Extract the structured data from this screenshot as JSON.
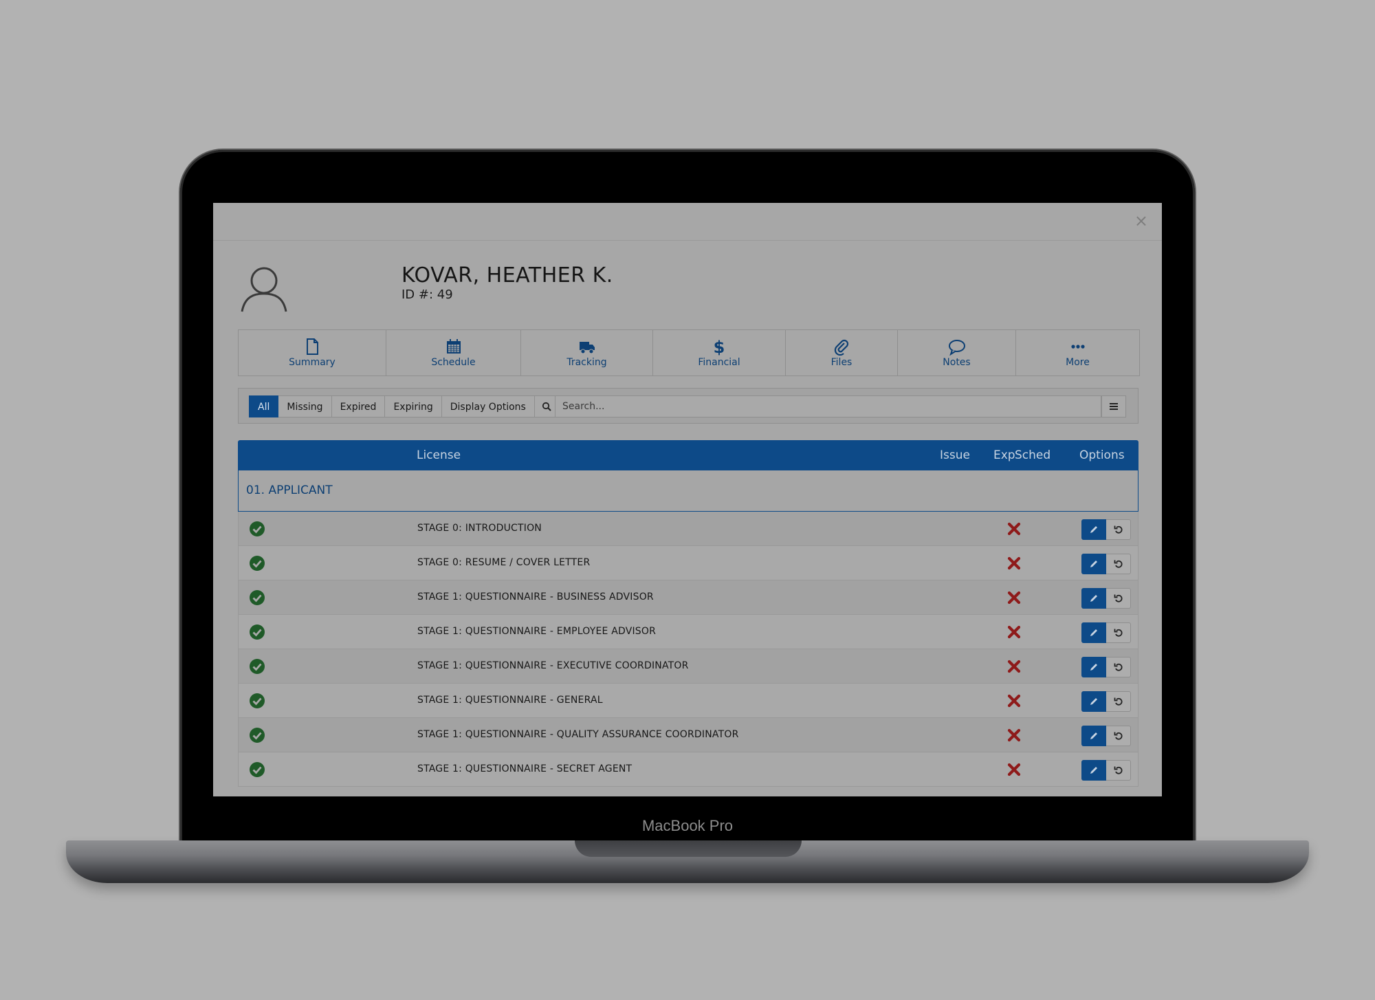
{
  "device": {
    "brand_label": "MacBook Pro"
  },
  "patient": {
    "name": "KOVAR, HEATHER K.",
    "id_line": "ID #: 49"
  },
  "nav_tabs": [
    {
      "label": "Summary",
      "icon": "document-icon"
    },
    {
      "label": "Schedule",
      "icon": "calendar-icon"
    },
    {
      "label": "Tracking",
      "icon": "truck-icon"
    },
    {
      "label": "Financial",
      "icon": "dollar-icon"
    },
    {
      "label": "Files",
      "icon": "paperclip-icon"
    },
    {
      "label": "Notes",
      "icon": "speech-bubble-icon"
    },
    {
      "label": "More",
      "icon": "ellipsis-icon"
    }
  ],
  "filters": {
    "buttons": [
      "All",
      "Missing",
      "Expired",
      "Expiring",
      "Display Options"
    ],
    "active": "All",
    "search_placeholder": "Search..."
  },
  "table": {
    "headers": {
      "license": "License",
      "issue": "Issue",
      "exp": "Exp",
      "sched": "Sched",
      "options": "Options"
    },
    "section": "01. APPLICANT",
    "rows": [
      {
        "label": "STAGE 0: INTRODUCTION"
      },
      {
        "label": "STAGE 0: RESUME / COVER LETTER"
      },
      {
        "label": "STAGE 1: QUESTIONNAIRE - BUSINESS ADVISOR"
      },
      {
        "label": "STAGE 1: QUESTIONNAIRE - EMPLOYEE ADVISOR"
      },
      {
        "label": "STAGE 1: QUESTIONNAIRE - EXECUTIVE COORDINATOR"
      },
      {
        "label": "STAGE 1: QUESTIONNAIRE - GENERAL"
      },
      {
        "label": "STAGE 1: QUESTIONNAIRE - QUALITY ASSURANCE COORDINATOR"
      },
      {
        "label": "STAGE 1: QUESTIONNAIRE - SECRET AGENT"
      }
    ]
  },
  "colors": {
    "accent": "#0d4a88",
    "check": "#1f5a28",
    "x_mark": "#8e1a1a"
  }
}
